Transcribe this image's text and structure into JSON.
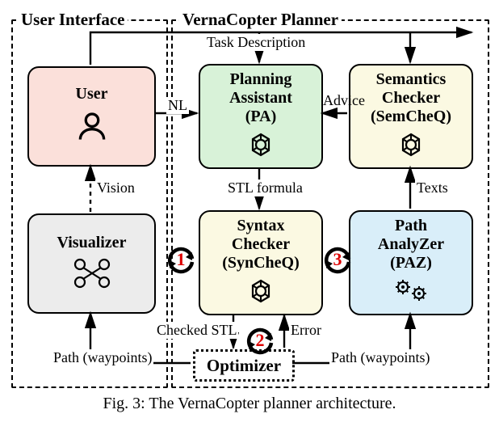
{
  "sections": {
    "ui_title": "User Interface",
    "planner_title": "VernaCopter Planner"
  },
  "nodes": {
    "user": {
      "label": "User"
    },
    "visualizer": {
      "label": "Visualizer"
    },
    "pa": {
      "label": "Planning\nAssistant\n(PA)"
    },
    "semcheq": {
      "label": "Semantics\nChecker\n(SemCheQ)"
    },
    "syncheq": {
      "label": "Syntax\nChecker\n(SynCheQ)"
    },
    "paz": {
      "label": "Path\nAnalyZer\n(PAZ)"
    },
    "optimizer": {
      "label": "Optimizer"
    }
  },
  "edges": {
    "task_desc": "Task Description",
    "nl": "NL",
    "advice": "Advice",
    "stl_formula": "STL formula",
    "checked_stl": "Checked STL",
    "error": "Error",
    "texts": "Texts",
    "path_left": "Path (waypoints)",
    "path_right": "Path (waypoints)",
    "vision": "Vision"
  },
  "cycles": {
    "c1": "1",
    "c2": "2",
    "c3": "3"
  },
  "caption": "Fig. 3: The VernaCopter planner architecture."
}
